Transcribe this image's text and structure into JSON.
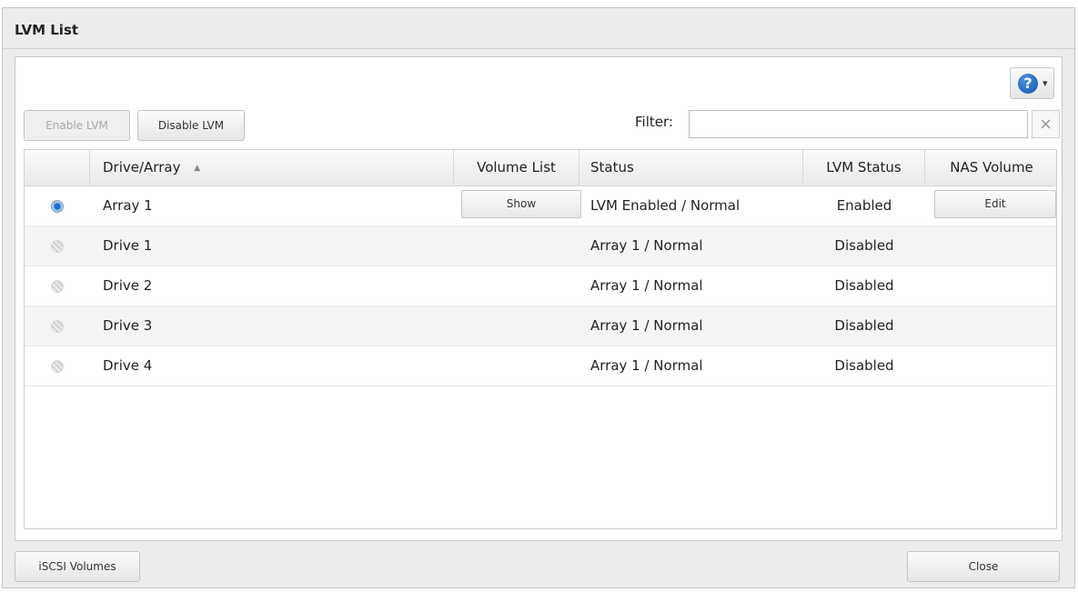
{
  "window": {
    "title": "LVM List"
  },
  "toolbar": {
    "enable_label": "Enable LVM",
    "disable_label": "Disable LVM",
    "filter_label": "Filter:",
    "filter_value": "",
    "clear_icon": "×",
    "help_icon": "?",
    "help_caret": "▾"
  },
  "table": {
    "columns": {
      "drive_array": "Drive/Array",
      "sort_indicator": "▲",
      "volume_list": "Volume List",
      "status": "Status",
      "lvm_status": "LVM Status",
      "nas_volume": "NAS Volume"
    },
    "rows": [
      {
        "name": "Array 1",
        "status": "LVM Enabled / Normal",
        "lvm_status": "Enabled",
        "volume_action": "Show",
        "nas_action": "Edit"
      },
      {
        "name": "Drive 1",
        "status": "Array 1 / Normal",
        "lvm_status": "Disabled"
      },
      {
        "name": "Drive 2",
        "status": "Array 1 / Normal",
        "lvm_status": "Disabled"
      },
      {
        "name": "Drive 3",
        "status": "Array 1 / Normal",
        "lvm_status": "Disabled"
      },
      {
        "name": "Drive 4",
        "status": "Array 1 / Normal",
        "lvm_status": "Disabled"
      }
    ]
  },
  "footer": {
    "iscsi_label": "iSCSI Volumes",
    "close_label": "Close"
  }
}
